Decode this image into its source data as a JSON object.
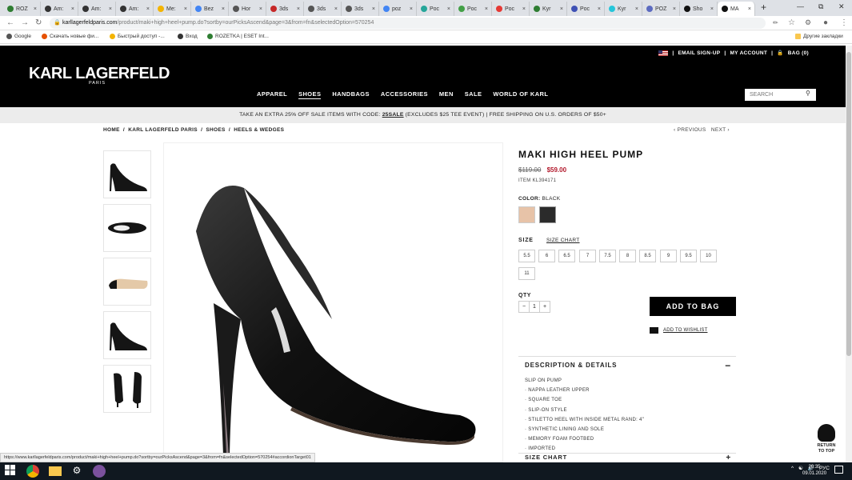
{
  "browser": {
    "tabs": [
      {
        "label": "ROZ",
        "color": "#2e7d32"
      },
      {
        "label": "Am:",
        "color": "#333"
      },
      {
        "label": "Am:",
        "color": "#333"
      },
      {
        "label": "Am:",
        "color": "#333"
      },
      {
        "label": "Me:",
        "color": "#f4b400"
      },
      {
        "label": "Bez",
        "color": "#4285f4"
      },
      {
        "label": "Hor",
        "color": "#555"
      },
      {
        "label": "3ds",
        "color": "#c62828"
      },
      {
        "label": "3ds",
        "color": "#555"
      },
      {
        "label": "3ds",
        "color": "#555"
      },
      {
        "label": "poz",
        "color": "#4285f4"
      },
      {
        "label": "Poc",
        "color": "#26a69a"
      },
      {
        "label": "Poc",
        "color": "#43a047"
      },
      {
        "label": "Poc",
        "color": "#e53935"
      },
      {
        "label": "Kyr",
        "color": "#2e7d32"
      },
      {
        "label": "Poc",
        "color": "#3f51b5"
      },
      {
        "label": "Kyr",
        "color": "#26c6da"
      },
      {
        "label": "POZ",
        "color": "#5c6bc0"
      },
      {
        "label": "Sho",
        "color": "#111"
      },
      {
        "label": "MA",
        "color": "#111"
      }
    ],
    "new_tab": "+",
    "url_host": "karllagerfeldparis.com",
    "url_path": "/product/maki+high+heel+pump.do?sortby=ourPicksAscend&page=3&from=fn&selectedOption=570254",
    "bookmarks": [
      "Google",
      "Скачать новые фи...",
      "Быстрый доступ -...",
      "Вход",
      "ROZETKA | ESET Int..."
    ],
    "other_bookmarks": "Другие закладки"
  },
  "header": {
    "logo": "KARL LAGERFELD",
    "logo_sub": "PARIS",
    "email_signup": "EMAIL SIGN-UP",
    "my_account": "MY ACCOUNT",
    "bag": "BAG (0)",
    "nav": [
      "APPAREL",
      "SHOES",
      "HANDBAGS",
      "ACCESSORIES",
      "MEN",
      "SALE",
      "WORLD OF KARL"
    ],
    "search_placeholder": "SEARCH"
  },
  "promo": {
    "pre": "TAKE AN EXTRA 25% OFF SALE ITEMS WITH CODE: ",
    "code": "25SALE",
    "post": " (EXCLUDES $25 TEE EVENT) | FREE SHIPPING ON U.S. ORDERS OF $50+"
  },
  "breadcrumb": [
    "HOME",
    "KARL LAGERFELD PARIS",
    "SHOES",
    "HEELS & WEDGES"
  ],
  "prev": "‹ PREVIOUS",
  "next": "NEXT ›",
  "product": {
    "title": "MAKI HIGH HEEL PUMP",
    "old_price": "$119.00",
    "new_price": "$59.00",
    "item": "ITEM KL394171",
    "color_label": "COLOR:",
    "color_value": "BLACK",
    "swatches": [
      "#e7c3a8",
      "#2b2b2b"
    ],
    "size_label": "SIZE",
    "size_chart": "SIZE CHART",
    "sizes": [
      "5.5",
      "6",
      "6.5",
      "7",
      "7.5",
      "8",
      "8.5",
      "9",
      "9.5",
      "10",
      "11"
    ],
    "qty_label": "QTY",
    "qty_minus": "−",
    "qty_value": "1",
    "qty_plus": "+",
    "add_to_bag": "ADD TO BAG",
    "add_to_wishlist": "ADD TO WISHLIST",
    "desc_title": "DESCRIPTION & DETAILS",
    "desc_toggle": "−",
    "desc_items": [
      "SLIP ON PUMP",
      "· NAPPA LEATHER UPPER",
      "· SQUARE TOE",
      "· SLIP-ON STYLE",
      "· STILETTO HEEL WITH INSIDE METAL RAND: 4\"",
      "· SYNTHETIC LINING AND SOLE",
      "· MEMORY FOAM FOOTBED",
      "· IMPORTED"
    ],
    "size_chart_title": "SIZE CHART",
    "size_chart_toggle": "+"
  },
  "return_to_top": "RETURN TO TOP",
  "status_url": "https://www.karllagerfeldparis.com/product/maki+high+heel+pump.do?sortby=ourPicksAscend&page=3&from=fn&selectedOption=570254#accordionTarget01",
  "taskbar": {
    "lang": "РУС",
    "time": "20:35",
    "date": "09.01.2020"
  }
}
